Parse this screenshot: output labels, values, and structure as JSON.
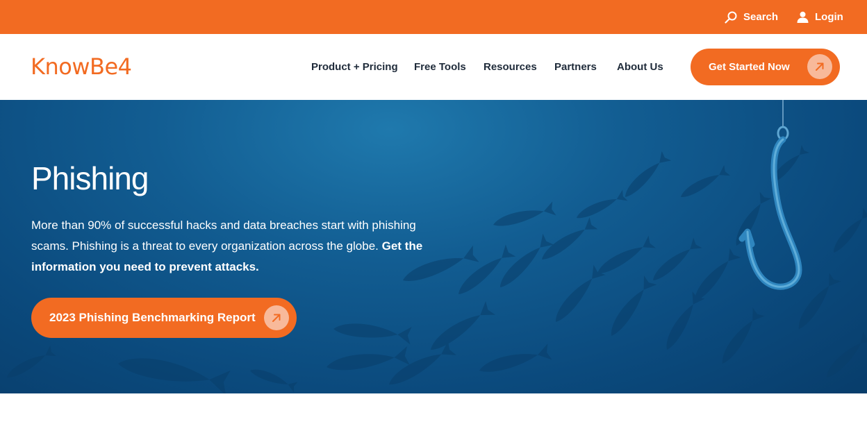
{
  "topbar": {
    "search_label": "Search",
    "login_label": "Login",
    "search_icon": "search-icon",
    "login_icon": "user-icon"
  },
  "header": {
    "logo_text": "KnowBe4",
    "nav": [
      {
        "label": "Product + Pricing"
      },
      {
        "label": "Free Tools"
      },
      {
        "label": "Resources"
      },
      {
        "label": "Partners"
      },
      {
        "label": "About Us"
      }
    ],
    "cta_label": "Get Started Now",
    "cta_icon": "arrow-up-right-icon"
  },
  "hero": {
    "title": "Phishing",
    "text_regular": "More than 90% of successful hacks and data breaches start with phishing scams. Phishing is a threat to every organization across the globe. ",
    "text_bold": "Get the information you need to prevent attacks.",
    "button_label": "2023 Phishing Benchmarking Report",
    "button_icon": "arrow-up-right-icon",
    "image": "fish-and-hook-icon"
  },
  "colors": {
    "brand_orange": "#f26b22",
    "arrow_circle": "#f8b99a",
    "nav_text": "#1f2b3a",
    "hero_blue": "#125d92"
  }
}
